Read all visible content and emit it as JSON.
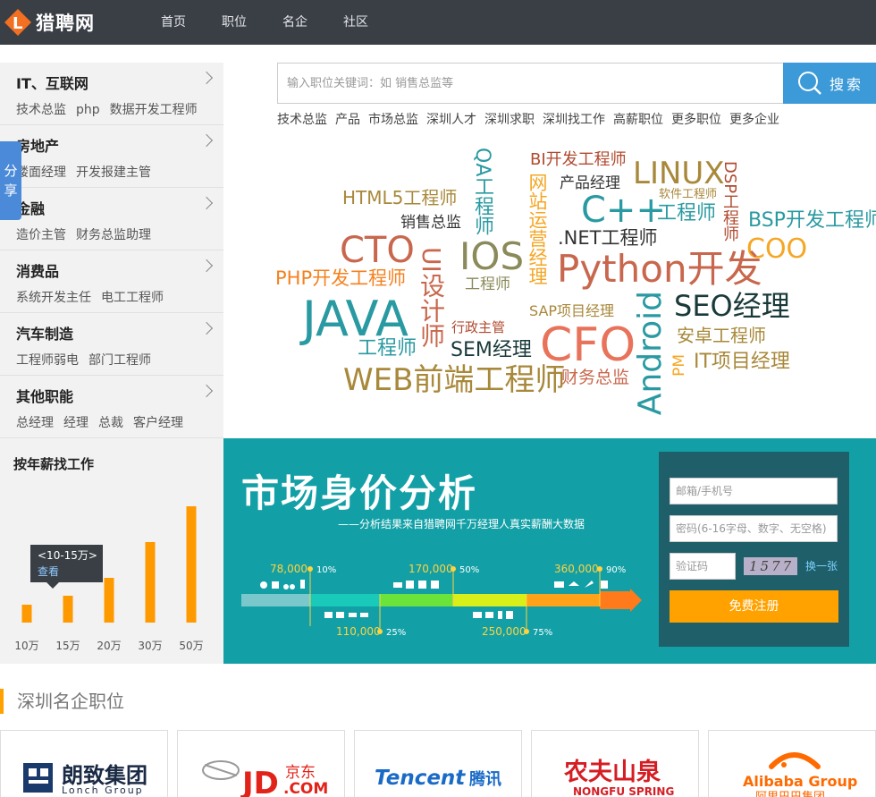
{
  "header": {
    "logo_text": "猎聘网",
    "nav": [
      "首页",
      "职位",
      "名企",
      "社区"
    ]
  },
  "share_label": "分享",
  "categories": [
    {
      "title": "IT、互联网",
      "links": [
        "技术总监",
        "php",
        "数据开发工程师"
      ]
    },
    {
      "title": "房地产",
      "links": [
        "楼面经理",
        "开发报建主管"
      ]
    },
    {
      "title": "金融",
      "links": [
        "造价主管",
        "财务总监助理"
      ]
    },
    {
      "title": "消费品",
      "links": [
        "系统开发主任",
        "电工工程师"
      ]
    },
    {
      "title": "汽车制造",
      "links": [
        "工程师弱电",
        "部门工程师"
      ]
    },
    {
      "title": "其他职能",
      "links": [
        "总经理",
        "经理",
        "总裁",
        "客户经理"
      ]
    }
  ],
  "salary_chart": {
    "title": "按年薪找工作",
    "tooltip": {
      "range": "<10-15万>",
      "link": "查看"
    }
  },
  "chart_data": {
    "type": "bar",
    "categories": [
      "10万",
      "15万",
      "20万",
      "30万",
      "50万"
    ],
    "values": [
      20,
      30,
      50,
      90,
      130
    ],
    "bar_color": "#ff9900"
  },
  "search": {
    "placeholder": "输入职位关键词：如 销售总监等",
    "button_label": "搜索",
    "hot_links": [
      "技术总监",
      "产品",
      "市场总监",
      "深圳人才",
      "深圳求职",
      "深圳找工作",
      "高薪职位",
      "更多职位",
      "更多企业"
    ]
  },
  "word_cloud": [
    {
      "text": "QA工程师",
      "color": "#2a9aa2"
    },
    {
      "text": "BI开发工程师",
      "color": "#b04a2f"
    },
    {
      "text": "产品经理",
      "color": "#333333"
    },
    {
      "text": "LINUX",
      "color": "#a8883a"
    },
    {
      "text": "软件工程师",
      "color": "#a8883a"
    },
    {
      "text": "DSP工程师",
      "color": "#b04a2f"
    },
    {
      "text": "HTML5工程师",
      "color": "#a8883a"
    },
    {
      "text": "网站运营经理",
      "color": "#f5a623"
    },
    {
      "text": "C++",
      "color": "#2a9aa2"
    },
    {
      "text": "工程师",
      "color": "#2a9aa2"
    },
    {
      "text": "BSP开发工程师",
      "color": "#2a9aa2"
    },
    {
      "text": "销售总监",
      "color": "#333333"
    },
    {
      "text": ".NET工程师",
      "color": "#333333"
    },
    {
      "text": "COO",
      "color": "#f5a623"
    },
    {
      "text": "CTO",
      "color": "#c8674d"
    },
    {
      "text": "IOS",
      "color": "#8a8a5a"
    },
    {
      "text": "UI设计师",
      "color": "#c8674d"
    },
    {
      "text": "Python开发",
      "color": "#c8674d"
    },
    {
      "text": "PHP开发工程师",
      "color": "#f5811f"
    },
    {
      "text": "工程师",
      "color": "#8a8a5a"
    },
    {
      "text": "JAVA",
      "color": "#2a9aa2"
    },
    {
      "text": "Android",
      "color": "#2a9aa2"
    },
    {
      "text": "SEO经理",
      "color": "#1a3a3a"
    },
    {
      "text": "SAP项目经理",
      "color": "#a8883a"
    },
    {
      "text": "行政主管",
      "color": "#b04a2f"
    },
    {
      "text": "CFO",
      "color": "#e8735a"
    },
    {
      "text": "安卓工程师",
      "color": "#a8883a"
    },
    {
      "text": "工程师",
      "color": "#2a9aa2"
    },
    {
      "text": "SEM经理",
      "color": "#1a3a3a"
    },
    {
      "text": "PM",
      "color": "#f5a623"
    },
    {
      "text": "IT项目经理",
      "color": "#a8883a"
    },
    {
      "text": "WEB前端工程师",
      "color": "#a8883a"
    },
    {
      "text": "财务总监",
      "color": "#c8674d"
    }
  ],
  "market": {
    "title": "市场身价分析",
    "subtitle": "——分析结果来自猎聘网千万经理人真实薪酬大数据",
    "markers": [
      {
        "value": "78,000",
        "pct": "10%"
      },
      {
        "value": "110,000",
        "pct": "25%"
      },
      {
        "value": "170,000",
        "pct": "50%"
      },
      {
        "value": "250,000",
        "pct": "75%"
      },
      {
        "value": "360,000",
        "pct": "90%"
      }
    ]
  },
  "register": {
    "email_placeholder": "邮箱/手机号",
    "password_placeholder": "密码(6-16字母、数字、无空格)",
    "captcha_placeholder": "验证码",
    "captcha_text": "1577",
    "refresh_label": "换一张",
    "button_label": "免费注册"
  },
  "companies": {
    "section_title": "深圳名企职位",
    "items": [
      {
        "name": "朗致集团",
        "sub": "Lonch Group"
      },
      {
        "name": "JD",
        "sub": "京东",
        "suffix": ".COM"
      },
      {
        "name": "Tencent",
        "sub": "腾讯"
      },
      {
        "name": "农夫山泉",
        "sub": "NONGFU SPRING"
      },
      {
        "name": "Alibaba Group",
        "sub": "阿里巴巴集团"
      }
    ]
  }
}
